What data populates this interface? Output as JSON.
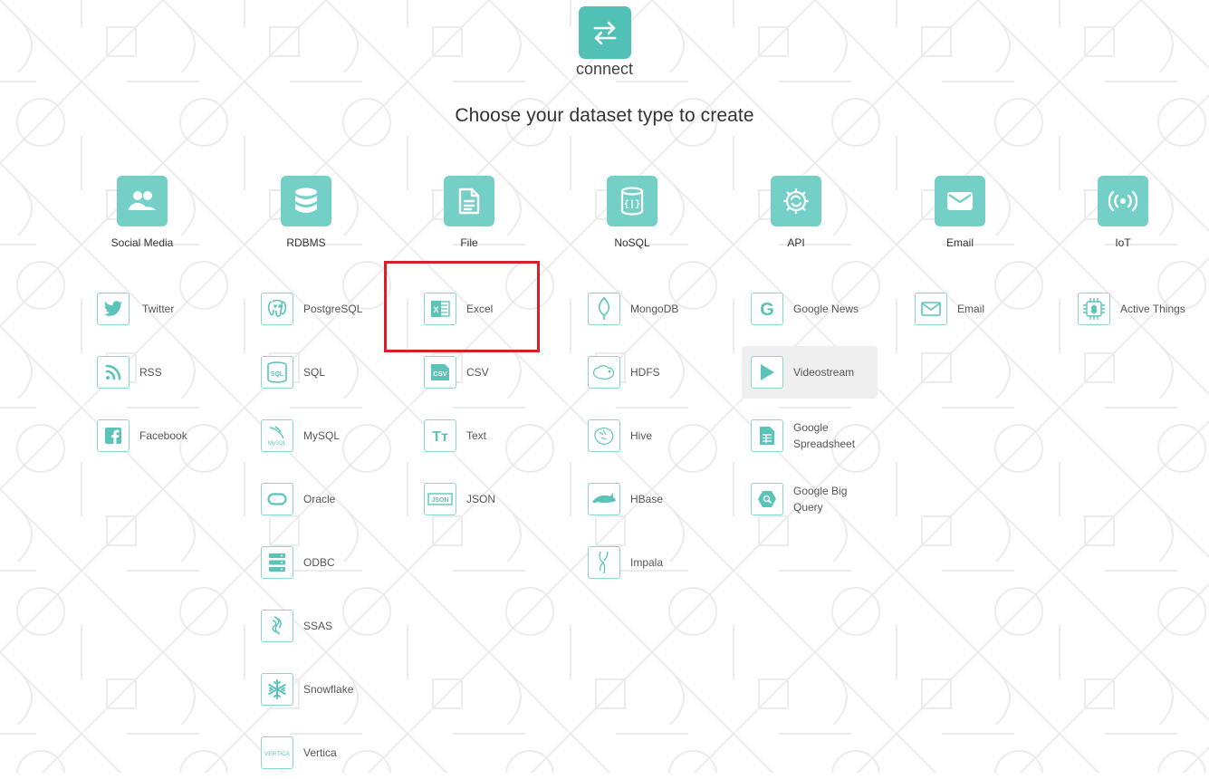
{
  "app": {
    "logo_text": "connect",
    "heading": "Choose your dataset type to create"
  },
  "colors": {
    "accent": "#51c1b5",
    "category_tile": "#74d0c6",
    "icon_border": "#8ad7ce",
    "highlight": "#d9202a"
  },
  "categories": [
    {
      "label": "Social Media",
      "icon": "users-icon"
    },
    {
      "label": "RDBMS",
      "icon": "database-icon"
    },
    {
      "label": "File",
      "icon": "file-icon"
    },
    {
      "label": "NoSQL",
      "icon": "nosql-icon"
    },
    {
      "label": "API",
      "icon": "api-gear-icon"
    },
    {
      "label": "Email",
      "icon": "envelope-icon"
    },
    {
      "label": "IoT",
      "icon": "broadcast-icon"
    }
  ],
  "sources": {
    "social": [
      {
        "label": "Twitter",
        "icon": "twitter-icon"
      },
      {
        "label": "RSS",
        "icon": "rss-icon"
      },
      {
        "label": "Facebook",
        "icon": "facebook-icon"
      }
    ],
    "rdbms": [
      {
        "label": "PostgreSQL",
        "icon": "postgresql-icon"
      },
      {
        "label": "SQL",
        "icon": "sql-icon",
        "tile": "SQL"
      },
      {
        "label": "MySQL",
        "icon": "mysql-icon",
        "tile": "MySQL"
      },
      {
        "label": "Oracle",
        "icon": "oracle-icon"
      },
      {
        "label": "ODBC",
        "icon": "odbc-icon"
      },
      {
        "label": "SSAS",
        "icon": "ssas-icon"
      },
      {
        "label": "Snowflake",
        "icon": "snowflake-icon"
      },
      {
        "label": "Vertica",
        "icon": "vertica-icon",
        "tile": "VERTICA"
      }
    ],
    "file": [
      {
        "label": "Excel",
        "icon": "excel-icon",
        "tile": "X"
      },
      {
        "label": "CSV",
        "icon": "csv-icon",
        "tile": "CSV"
      },
      {
        "label": "Text",
        "icon": "text-icon",
        "tile": "Tт"
      },
      {
        "label": "JSON",
        "icon": "json-icon",
        "tile": "JSON"
      }
    ],
    "nosql": [
      {
        "label": "MongoDB",
        "icon": "mongodb-icon"
      },
      {
        "label": "HDFS",
        "icon": "hdfs-icon"
      },
      {
        "label": "Hive",
        "icon": "hive-icon"
      },
      {
        "label": "HBase",
        "icon": "hbase-icon"
      },
      {
        "label": "Impala",
        "icon": "impala-icon"
      }
    ],
    "api": [
      {
        "label": "Google News",
        "icon": "google-icon",
        "tile": "G"
      },
      {
        "label": "Videostream",
        "icon": "play-icon",
        "active": true
      },
      {
        "label": "Google Spreadsheet",
        "icon": "spreadsheet-icon"
      },
      {
        "label": "Google Big Query",
        "icon": "bigquery-icon"
      }
    ],
    "email": [
      {
        "label": "Email",
        "icon": "envelope-outline-icon"
      }
    ],
    "iot": [
      {
        "label": "Active Things",
        "icon": "chip-icon",
        "tile": "$"
      }
    ]
  }
}
